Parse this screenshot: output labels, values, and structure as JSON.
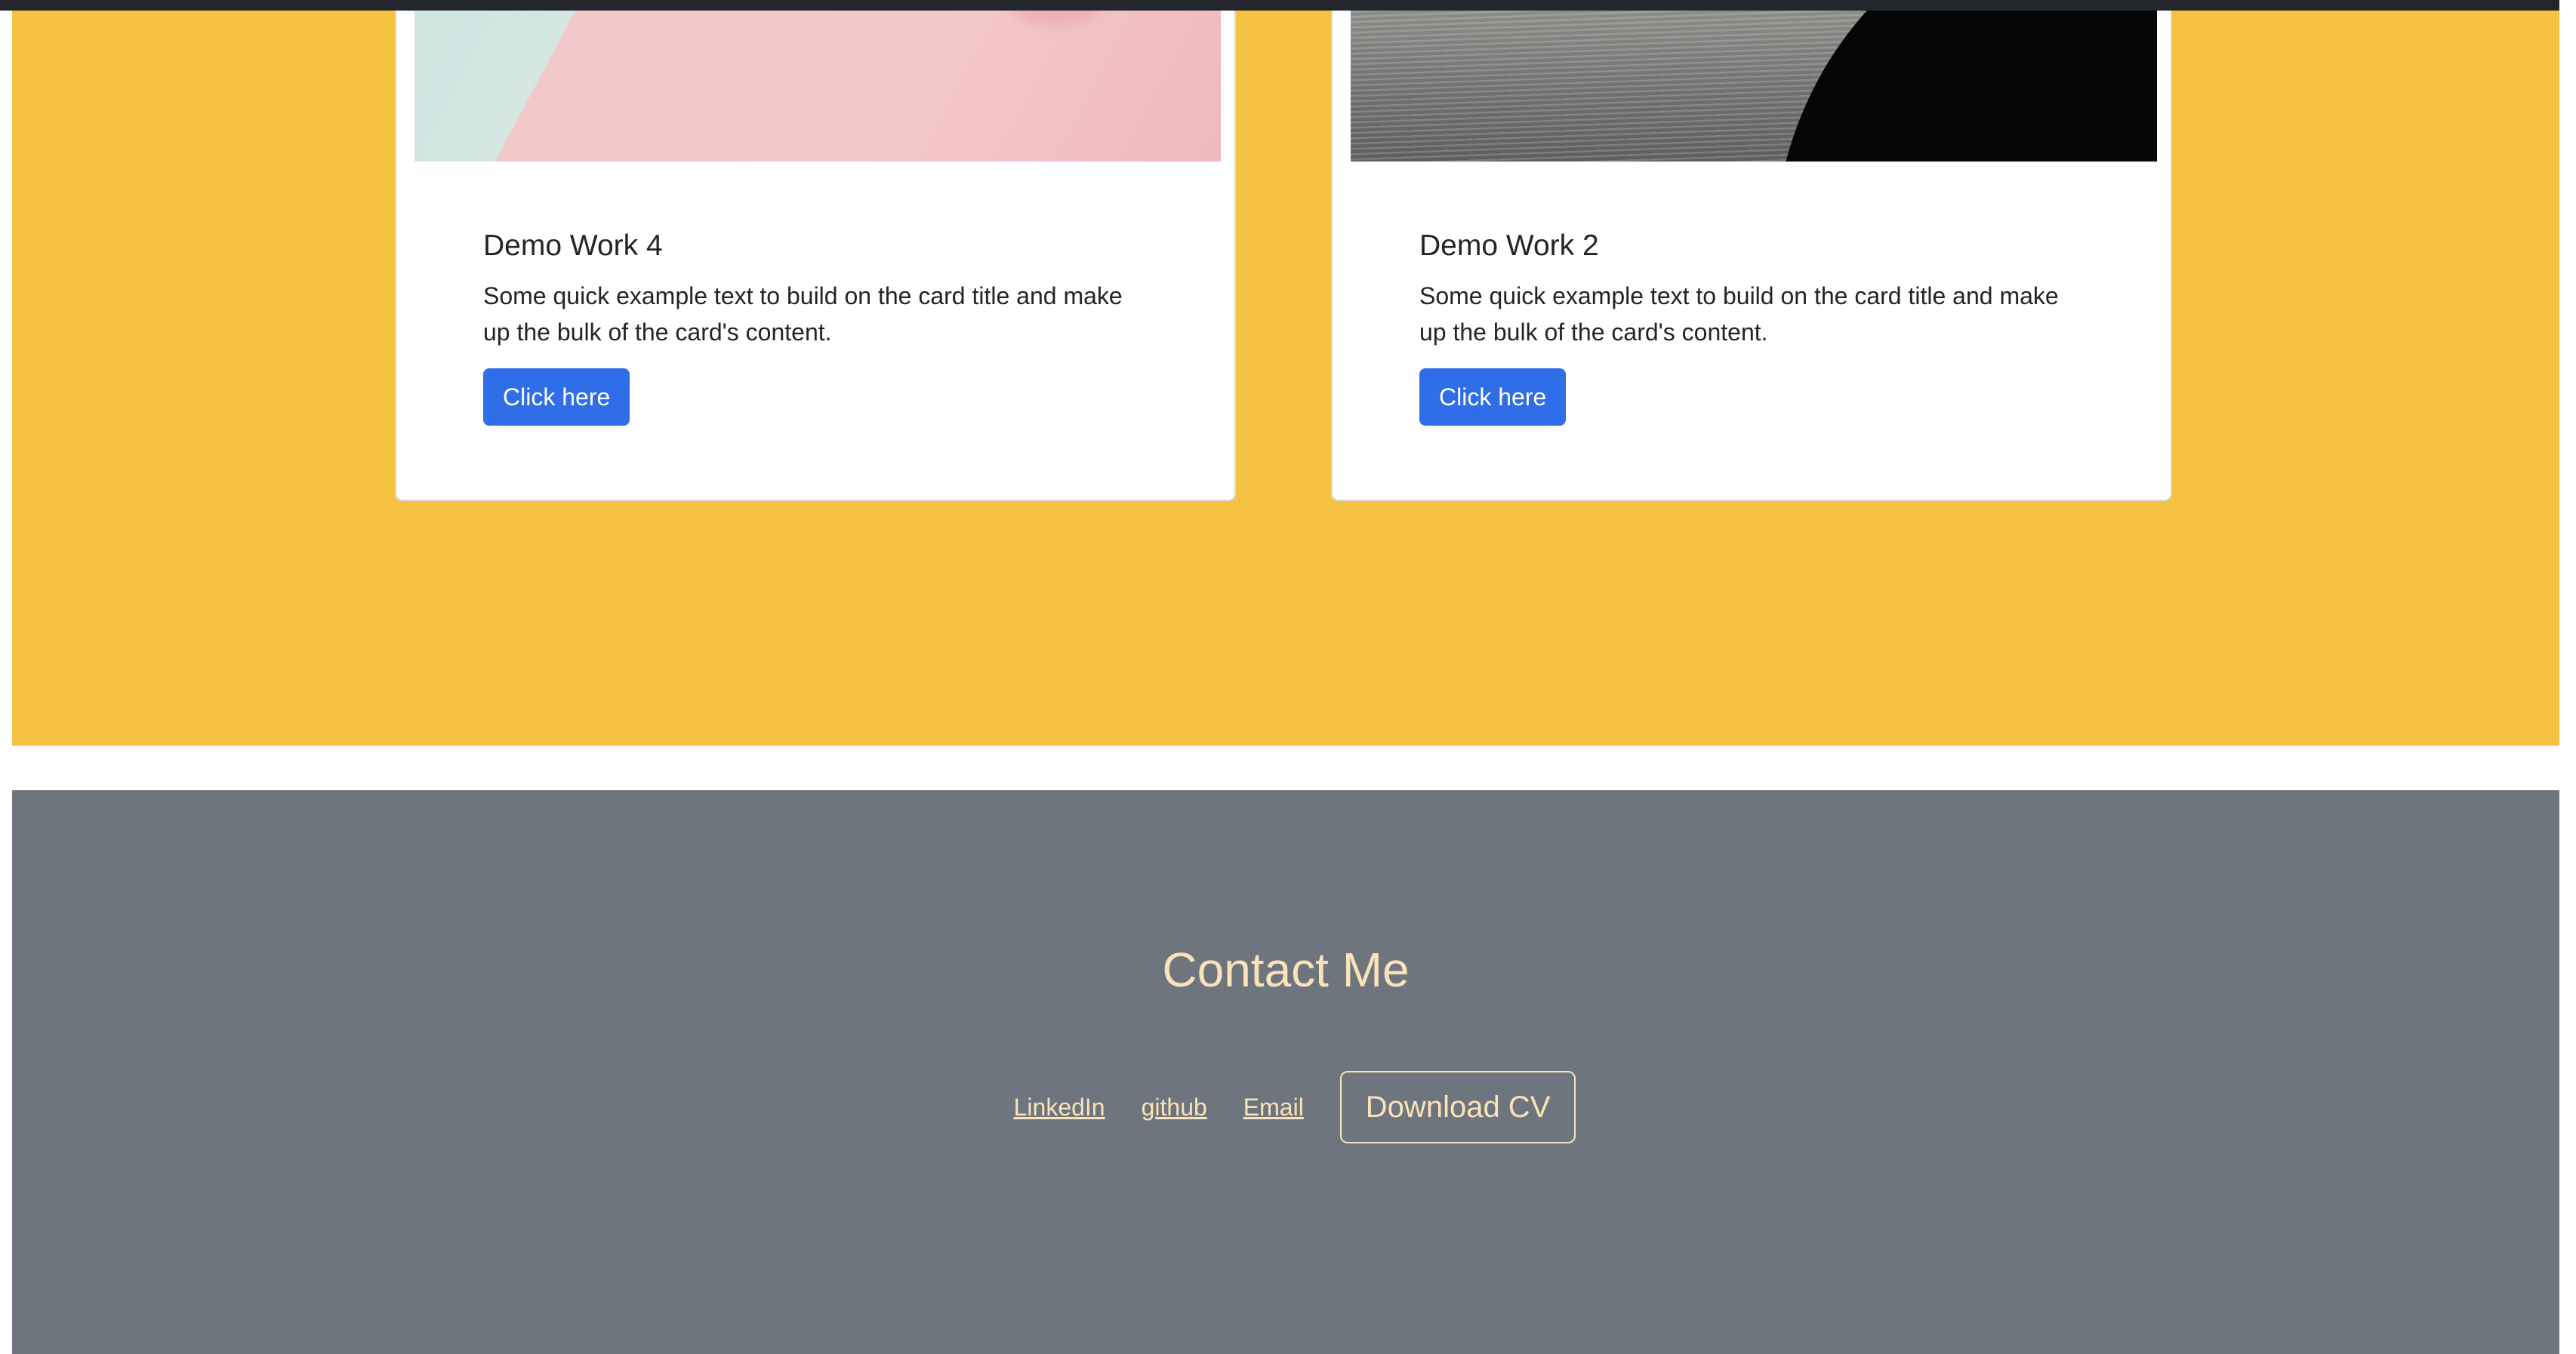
{
  "works": {
    "cards": [
      {
        "title": "Demo Work 4",
        "text": "Some quick example text to build on the card title and make up the bulk of the card's content.",
        "button_label": "Click here",
        "image_icon": "pastel-abstract-image"
      },
      {
        "title": "Demo Work 2",
        "text": "Some quick example text to build on the card title and make up the bulk of the card's content.",
        "button_label": "Click here",
        "image_icon": "ocean-silhouette-image"
      }
    ]
  },
  "contact": {
    "title": "Contact Me",
    "links": [
      "LinkedIn",
      "github",
      "Email"
    ],
    "cv_button": "Download CV"
  },
  "colors": {
    "works_background": "#f5c242",
    "contact_background": "#6e757f",
    "accent_text": "#fbe3b8",
    "primary_button": "#2f6ee8"
  }
}
